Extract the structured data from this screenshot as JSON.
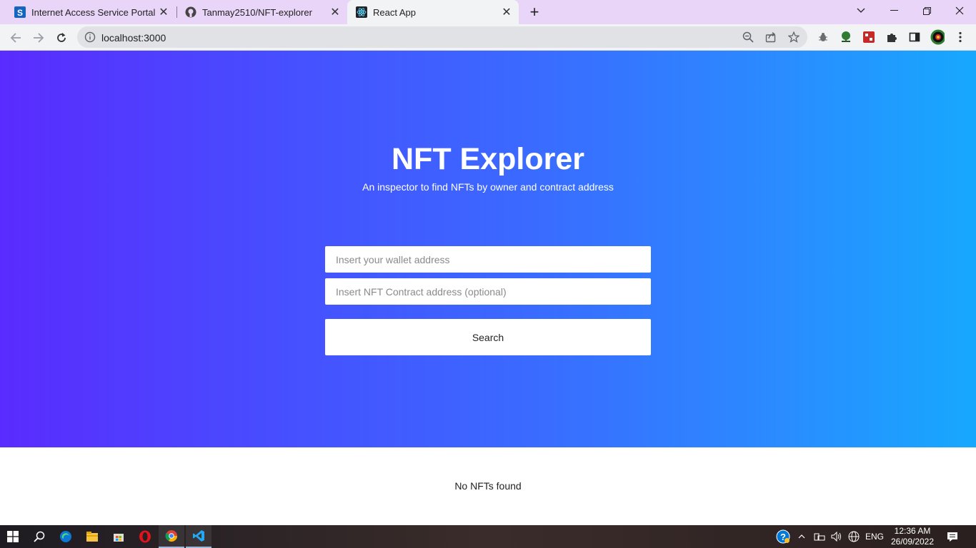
{
  "browser": {
    "tabs": [
      {
        "title": "Internet Access Service Portal",
        "icon": "s-portal-icon"
      },
      {
        "title": "Tanmay2510/NFT-explorer",
        "icon": "github-icon"
      },
      {
        "title": "React App",
        "icon": "react-icon"
      }
    ],
    "url": "localhost:3000"
  },
  "page": {
    "title": "NFT Explorer",
    "subtitle": "An inspector to find NFTs by owner and contract address",
    "wallet_placeholder": "Insert your wallet address",
    "contract_placeholder": "Insert NFT Contract address (optional)",
    "search_label": "Search",
    "empty_message": "No NFTs found"
  },
  "taskbar": {
    "language": "ENG",
    "time": "12:36 AM",
    "date": "26/09/2022"
  },
  "colors": {
    "gradient_start": "#5a2bfe",
    "gradient_end": "#17a8fe",
    "tabstrip": "#e8d5f7"
  }
}
